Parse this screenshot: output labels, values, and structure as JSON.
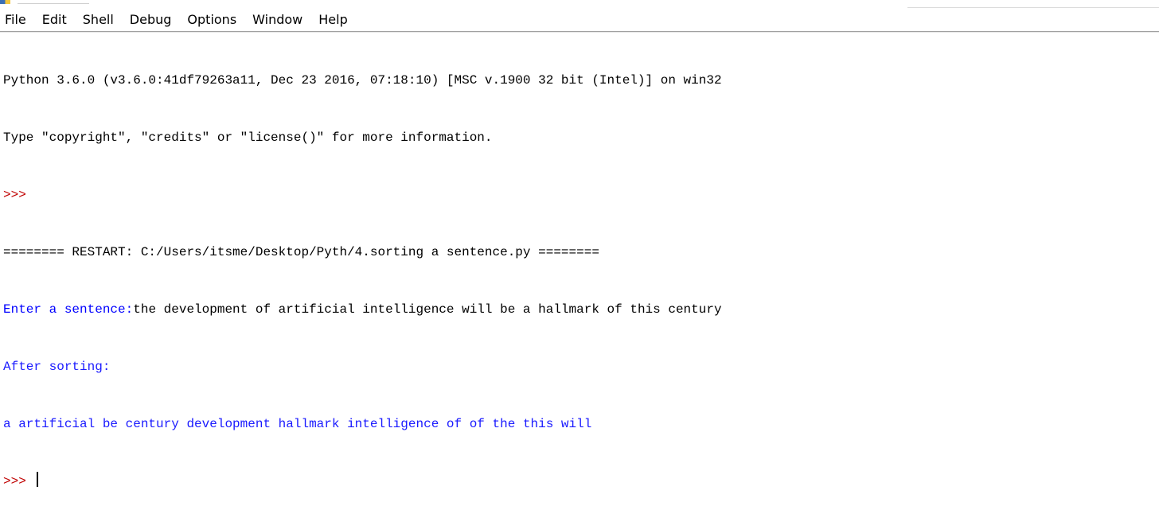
{
  "menubar": {
    "items": [
      "File",
      "Edit",
      "Shell",
      "Debug",
      "Options",
      "Window",
      "Help"
    ]
  },
  "shell": {
    "banner_line1": "Python 3.6.0 (v3.6.0:41df79263a11, Dec 23 2016, 07:18:10) [MSC v.1900 32 bit (Intel)] on win32",
    "banner_line2": "Type \"copyright\", \"credits\" or \"license()\" for more information.",
    "prompt": ">>> ",
    "restart_line": "======== RESTART: C:/Users/itsme/Desktop/Pyth/4.sorting a sentence.py ========",
    "input_prompt": "Enter a sentence:",
    "input_value": "the development of artificial intelligence will be a hallmark of this century",
    "after_sorting": "After sorting:",
    "sorted_result": "a artificial be century development hallmark intelligence of of the this will",
    "final_prompt": ">>> "
  },
  "colors": {
    "prompt": "#c00000",
    "stdout_program": "#1a1aff",
    "stdin": "#000000",
    "background": "#ffffff"
  }
}
